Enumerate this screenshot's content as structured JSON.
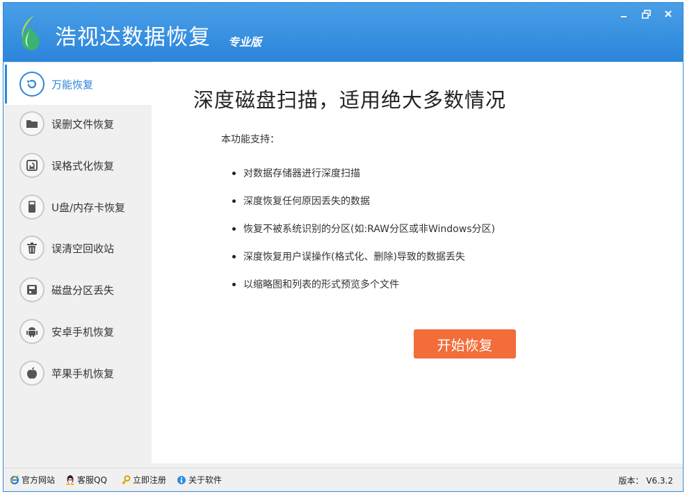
{
  "app": {
    "title": "浩视达数据恢复",
    "edition": "专业版",
    "brand_color": "#2b85db",
    "logo_icon": "water-drop-leaf-logo"
  },
  "window_controls": {
    "minimize_icon": "minimize-icon",
    "restore_icon": "restore-icon",
    "close_icon": "close-icon"
  },
  "sidebar": {
    "items": [
      {
        "label": "万能恢复",
        "icon": "refresh-icon",
        "active": true
      },
      {
        "label": "误删文件恢复",
        "icon": "folder-icon"
      },
      {
        "label": "误格式化恢复",
        "icon": "format-disk-icon"
      },
      {
        "label": "U盘/内存卡恢复",
        "icon": "usb-drive-icon"
      },
      {
        "label": "误清空回收站",
        "icon": "trash-icon"
      },
      {
        "label": "磁盘分区丢失",
        "icon": "disk-partition-icon"
      },
      {
        "label": "安卓手机恢复",
        "icon": "android-icon"
      },
      {
        "label": "苹果手机恢复",
        "icon": "apple-icon"
      }
    ]
  },
  "main": {
    "heading": "深度磁盘扫描，适用绝大多数情况",
    "intro": "本功能支持：",
    "features": [
      "对数据存储器进行深度扫描",
      "深度恢复任何原因丢失的数据",
      "恢复不被系统识别的分区(如:RAW分区或非Windows分区)",
      "深度恢复用户误操作(格式化、删除)导致的数据丢失",
      "以缩略图和列表的形式预览多个文件"
    ],
    "start_button": "开始恢复",
    "start_button_color": "#f36d3b"
  },
  "footer": {
    "links": [
      {
        "label": "官方网站",
        "icon": "ie-browser-icon"
      },
      {
        "label": "客服QQ",
        "icon": "qq-penguin-icon"
      },
      {
        "label": "立即注册",
        "icon": "key-icon"
      },
      {
        "label": "关于软件",
        "icon": "info-globe-icon"
      }
    ],
    "version": "版本： V6.3.2"
  }
}
